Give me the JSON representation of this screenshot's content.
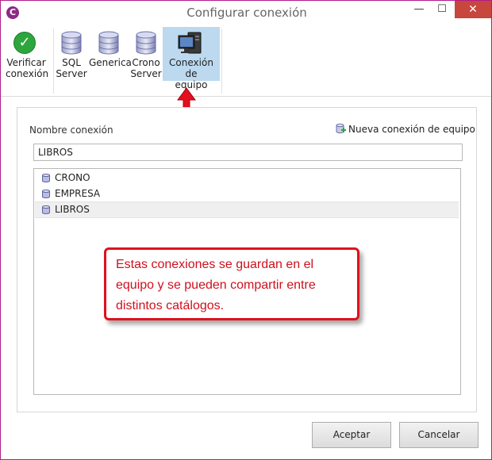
{
  "window": {
    "title": "Configurar conexión",
    "app_icon": "C",
    "controls": {
      "minimize": "—",
      "maximize": "☐",
      "close": "✕"
    }
  },
  "ribbon": {
    "items": [
      {
        "label_line1": "Verificar",
        "label_line2": "conexión",
        "icon": "check-icon"
      },
      {
        "label_line1": "SQL",
        "label_line2": "Server",
        "icon": "database-icon"
      },
      {
        "label_line1": "Generica",
        "label_line2": "",
        "icon": "database-icon"
      },
      {
        "label_line1": "Crono",
        "label_line2": "Server",
        "icon": "database-icon"
      },
      {
        "label_line1": "Conexión de",
        "label_line2": "equipo",
        "icon": "computer-icon",
        "active": true
      }
    ]
  },
  "form": {
    "name_label": "Nombre conexión",
    "new_link": "Nueva conexión de equipo",
    "name_value": "LIBROS"
  },
  "connections": [
    {
      "label": "CRONO"
    },
    {
      "label": "EMPRESA"
    },
    {
      "label": "LIBROS",
      "selected": true
    }
  ],
  "callout": {
    "line1": "Estas conexiones se guardan en el",
    "line2": "equipo y se pueden compartir entre",
    "line3": "distintos catálogos."
  },
  "buttons": {
    "ok": "Aceptar",
    "cancel": "Cancelar"
  },
  "colors": {
    "accent_border": "#b01e8a",
    "close_button": "#c7463d",
    "active_tab": "#bcd9f0",
    "callout_red": "#e0101e"
  }
}
